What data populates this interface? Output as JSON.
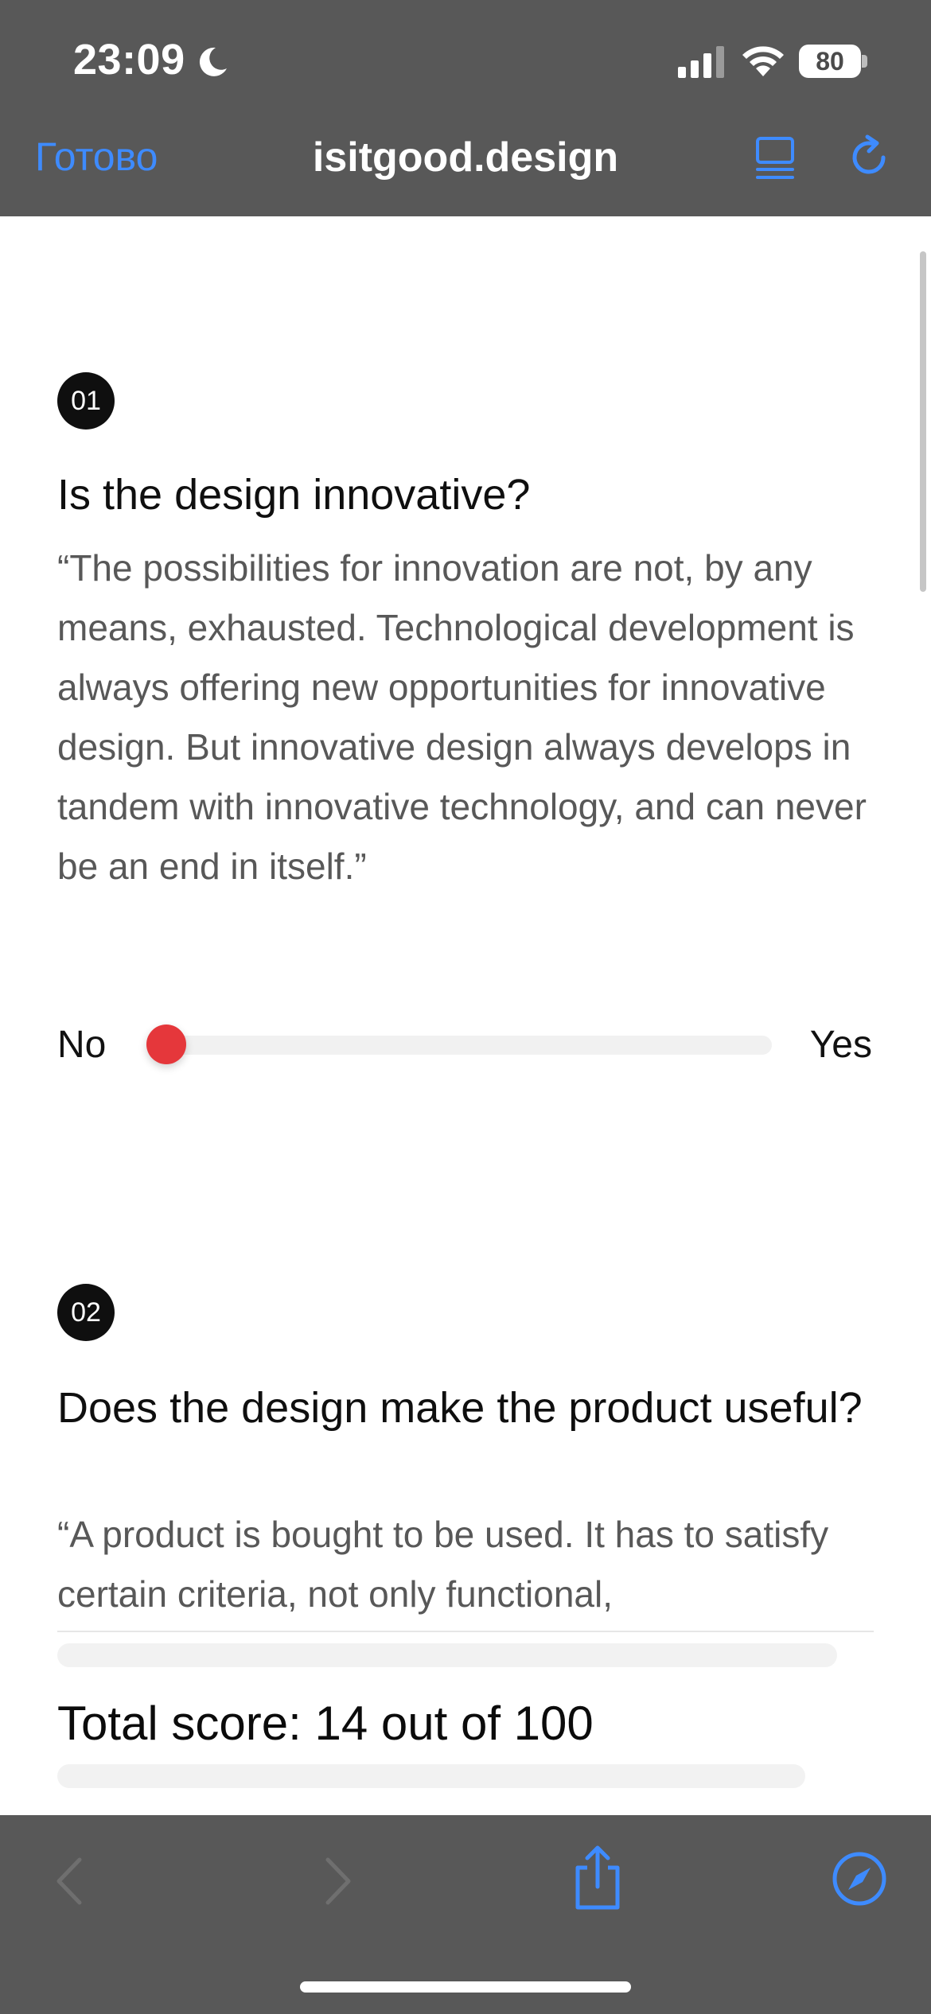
{
  "status_bar": {
    "time": "23:09",
    "battery": "80"
  },
  "nav": {
    "done_label": "Готово",
    "title": "isitgood.design"
  },
  "questions": [
    {
      "number": "01",
      "title": "Is the design innovative?",
      "quote": "“The possibilities for innovation are not, by any means, exhausted. Technological development is always offering new opportunities for innovative design. But innovative design always develops in tandem with innovative technology, and can never be an end in itself.”",
      "slider": {
        "min_label": "No",
        "max_label": "Yes",
        "value_fraction": 0.0
      }
    },
    {
      "number": "02",
      "title": "Does the design make the product useful?",
      "quote": "“A product is bought to be used. It has to satisfy certain criteria, not only functional,"
    }
  ],
  "score": {
    "text": "Total score: 14 out of 100"
  },
  "colors": {
    "accent": "#3e8bff",
    "slider_thumb": "#e5373b",
    "bar_bg": "#585858"
  },
  "icons": {
    "moon": "moon-icon",
    "signal": "cellular-signal-icon",
    "wifi": "wifi-icon",
    "battery": "battery-icon",
    "reader": "reader-mode-icon",
    "reload": "reload-icon",
    "back": "chevron-left-icon",
    "forward": "chevron-right-icon",
    "share": "share-icon",
    "compass": "compass-icon"
  }
}
